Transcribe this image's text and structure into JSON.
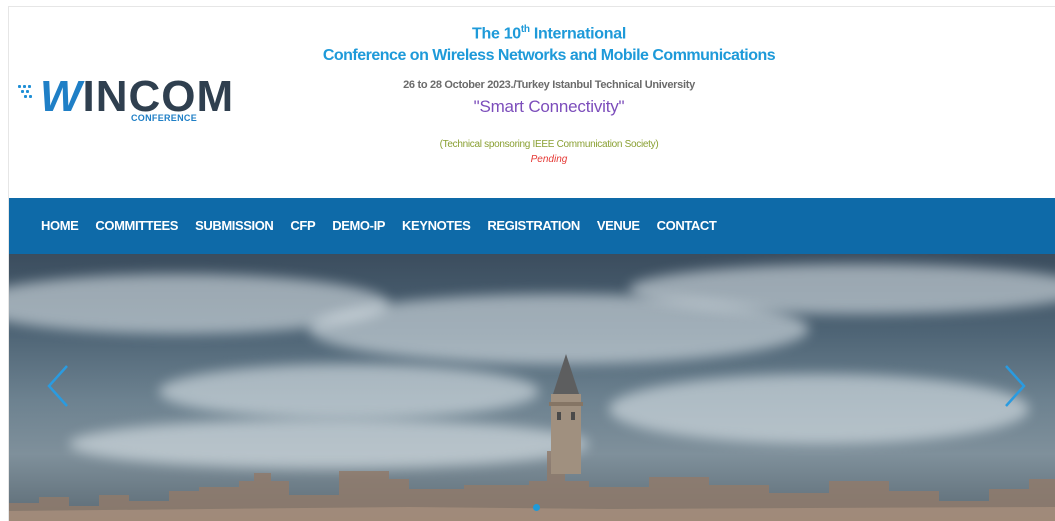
{
  "header": {
    "logo": {
      "wordmark": "WINCOM",
      "sub": "CONFERENCE"
    },
    "title_prefix": "The 10",
    "title_sup": "th",
    "title_suffix": " International",
    "conference_name": "Conference on Wireless Networks and Mobile Communications",
    "date_location": "26 to 28 October 2023./Turkey Istanbul Technical University",
    "theme": "\"Smart Connectivity\"",
    "sponsoring": "(Technical sponsoring IEEE Communication Society)",
    "status": "Pending"
  },
  "nav": {
    "items": [
      "HOME",
      "COMMITTEES",
      "SUBMISSION",
      "CFP",
      "DEMO-IP",
      "KEYNOTES",
      "REGISTRATION",
      "VENUE",
      "CONTACT"
    ]
  },
  "slider": {
    "prev_icon": "chevron-left-icon",
    "next_icon": "chevron-right-icon",
    "active_slide": 1
  },
  "colors": {
    "nav_bg": "#0e6aa8",
    "title": "#1e9ad9",
    "theme": "#7c4dbb",
    "sponsor": "#8aa033",
    "pending": "#e53935"
  }
}
